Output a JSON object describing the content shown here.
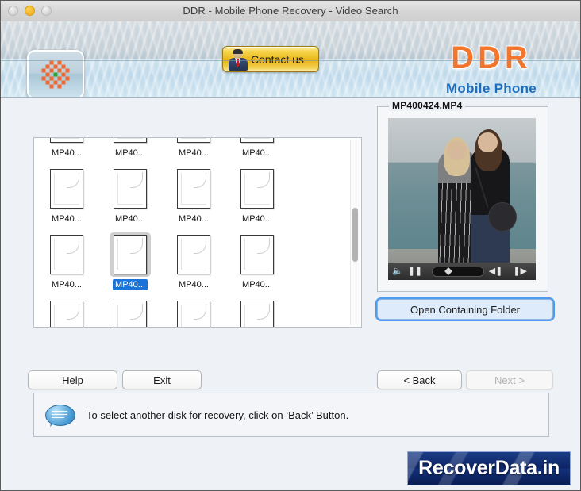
{
  "window": {
    "title": "DDR - Mobile Phone Recovery - Video Search",
    "traffic_lights": [
      "close-disabled",
      "minimize-amber",
      "zoom-disabled"
    ]
  },
  "header": {
    "app_icon_name": "ddr-app-icon",
    "contact_button_label": "Contact us",
    "brand_title": "DDR",
    "brand_subtitle": "Mobile Phone",
    "brand_color": "#f4762c",
    "brand_subtitle_color": "#1d6fbe"
  },
  "file_list": {
    "selected_index": 9,
    "items": [
      {
        "label": "MP40..."
      },
      {
        "label": "MP40..."
      },
      {
        "label": "MP40..."
      },
      {
        "label": "MP40..."
      },
      {
        "label": "MP40..."
      },
      {
        "label": "MP40..."
      },
      {
        "label": "MP40..."
      },
      {
        "label": "MP40..."
      },
      {
        "label": "MP40..."
      },
      {
        "label": "MP40..."
      },
      {
        "label": "MP40..."
      },
      {
        "label": "MP40..."
      },
      {
        "label": "MP40..."
      },
      {
        "label": "MP40..."
      },
      {
        "label": "MP40..."
      },
      {
        "label": "MP40..."
      },
      {
        "label": "MP40..."
      },
      {
        "label": "MP40..."
      },
      {
        "label": "MP40..."
      },
      {
        "label": "MP40..."
      }
    ],
    "scrollbar": {
      "name": "vertical-scrollbar"
    }
  },
  "preview": {
    "file_name": "MP400424.MP4",
    "controls": {
      "volume_icon": "speaker-icon",
      "pause_icon": "pause-icon",
      "step_back_icon": "step-backward-icon",
      "step_forward_icon": "step-forward-icon",
      "progress_percent": 32
    }
  },
  "actions": {
    "open_folder_label": "Open Containing Folder",
    "help_label": "Help",
    "exit_label": "Exit",
    "back_label": "< Back",
    "next_label": "Next >",
    "next_disabled": true
  },
  "status": {
    "icon": "speech-bubble-icon",
    "message": "To select another disk for recovery, click on ‘Back’ Button."
  },
  "badge": {
    "text": "RecoverData.in",
    "background_color": "#0e2566"
  }
}
